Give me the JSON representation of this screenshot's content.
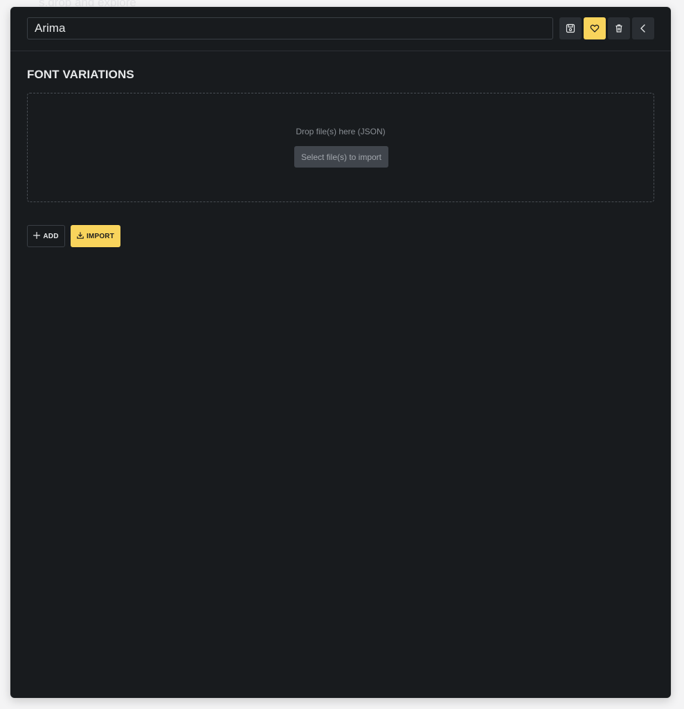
{
  "backdrop": {
    "text": "s.drop and explore"
  },
  "header": {
    "name_value": "Arima",
    "buttons": {
      "save_icon": "save-icon",
      "favorite_icon": "heart-icon",
      "delete_icon": "trash-icon",
      "back_icon": "chevron-left-icon"
    }
  },
  "section": {
    "title": "FONT VARIATIONS"
  },
  "dropzone": {
    "hint": "Drop file(s) here (JSON)",
    "select_label": "Select file(s) to import"
  },
  "actions": {
    "add_label": "ADD",
    "import_label": "IMPORT"
  },
  "colors": {
    "panel_bg": "#181b1e",
    "accent": "#f9d45c",
    "button_bg": "#2a2e33",
    "text": "#e7e9ea",
    "muted_text": "#8a8f95"
  }
}
